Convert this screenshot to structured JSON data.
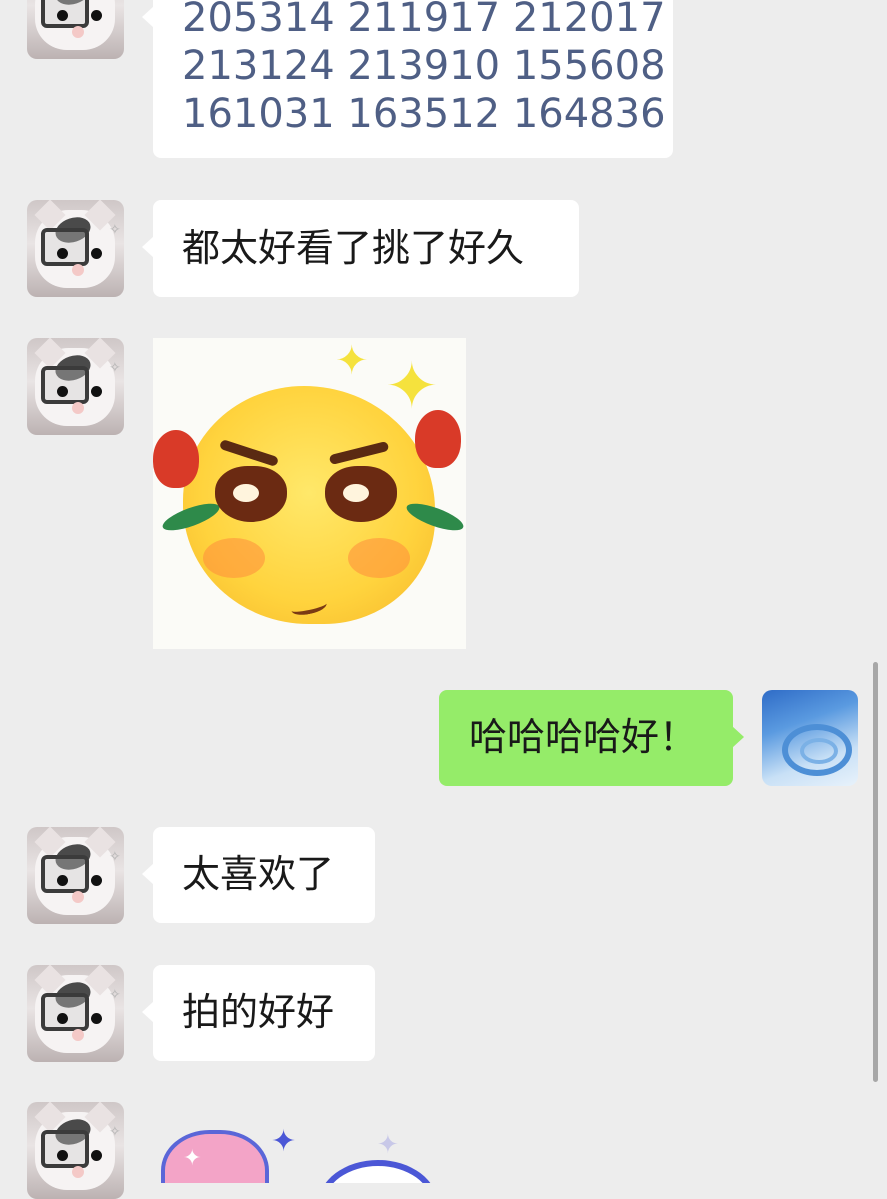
{
  "chat": {
    "messages": [
      {
        "side": "left",
        "kind": "text",
        "lines": [
          "205314 211917 212017",
          "213124  213910 155608",
          "161031 163512 164836"
        ]
      },
      {
        "side": "left",
        "kind": "text",
        "text": "都太好看了挑了好久"
      },
      {
        "side": "left",
        "kind": "sticker",
        "icon": "blushing-face-sticker"
      },
      {
        "side": "right",
        "kind": "text",
        "text": "哈哈哈哈好！"
      },
      {
        "side": "left",
        "kind": "text",
        "text": "太喜欢了"
      },
      {
        "side": "left",
        "kind": "text",
        "text": "拍的好好"
      },
      {
        "side": "left",
        "kind": "sticker",
        "icon": "hearts-sticker"
      }
    ]
  },
  "colors": {
    "background": "#ededed",
    "incoming_bubble": "#ffffff",
    "outgoing_bubble": "#95ec69",
    "number_text": "#4f5f85"
  },
  "icons": {
    "contact_avatar": "cat-avatar",
    "my_avatar": "blue-swirl-avatar"
  }
}
